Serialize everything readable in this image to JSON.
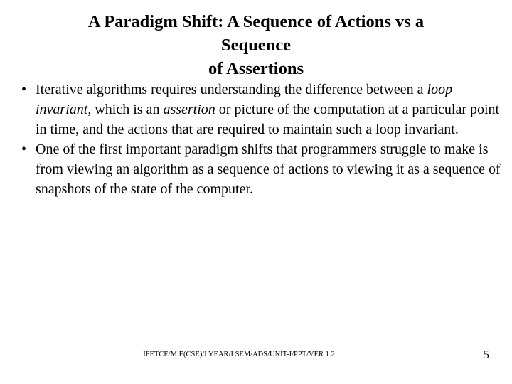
{
  "slide": {
    "title_lines": [
      "A Paradigm Shift: A Sequence of Actions vs a",
      "Sequence",
      "of Assertions"
    ],
    "bullet_marker": "•",
    "bullets": [
      {
        "segments": [
          {
            "text": "Iterative algorithms requires understanding the difference between a ",
            "style": "normal"
          },
          {
            "text": "loop invariant,",
            "style": "italic"
          },
          {
            "text": " which is an ",
            "style": "normal"
          },
          {
            "text": "assertion",
            "style": "italic"
          },
          {
            "text": " or picture of the computation at a particular point in time, and the actions that are required to maintain such a loop invariant.",
            "style": "normal"
          }
        ]
      },
      {
        "segments": [
          {
            "text": "One of the first important paradigm shifts that programmers struggle to make is from viewing an algorithm as a sequence of actions to viewing it as a sequence of snapshots of the state of the computer.",
            "style": "normal"
          }
        ]
      }
    ],
    "footer_note": "IFETCE/M.E(CSE)/I YEAR/I SEM/ADS/UNIT-I/PPT/VER 1.2",
    "page_number": "5",
    "text_color": "#000000",
    "background_color": "#ffffff"
  }
}
